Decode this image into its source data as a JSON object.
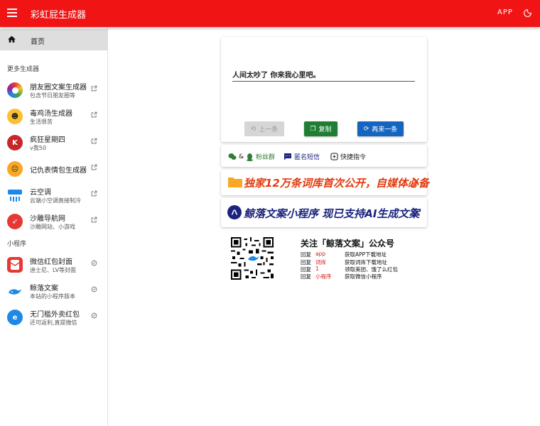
{
  "appbar": {
    "title": "彩虹屁生成器",
    "app_label": "APP"
  },
  "sidebar": {
    "home_label": "首页",
    "more_head": "更多生成器",
    "more_items": [
      {
        "title": "朋友圈文案生成器",
        "sub": "包含节日朋友圈等",
        "icon": "colorful-circle-icon"
      },
      {
        "title": "毒鸡汤生成器",
        "sub": "生活很苦",
        "icon": "emoji-face-icon"
      },
      {
        "title": "疯狂星期四",
        "sub": "v我50",
        "icon": "kfc-icon"
      },
      {
        "title": "记仇表情包生成器",
        "sub": "",
        "icon": "grudge-emoji-icon"
      },
      {
        "title": "云空调",
        "sub": "云端小空调直接制冷",
        "icon": "aircon-icon"
      },
      {
        "title": "沙雕导航网",
        "sub": "沙雕网站、小游戏",
        "icon": "compass-icon"
      }
    ],
    "mini_head": "小程序",
    "mini_items": [
      {
        "title": "微信红包封面",
        "sub": "迪士尼、LV等封面",
        "icon": "red-envelope-icon"
      },
      {
        "title": "鲸落文案",
        "sub": "本站的小程序版本",
        "icon": "whale-icon"
      },
      {
        "title": "无门槛外卖红包",
        "sub": "还可返利,直提微信",
        "icon": "ele-icon"
      }
    ]
  },
  "main": {
    "quote": "人间太吵了 你来我心里吧。",
    "prev_label": "上一条",
    "copy_label": "复制",
    "next_label": "再来一条",
    "links": {
      "fans": "粉丝群",
      "fans_prefix": "&",
      "sms": "匿名短信",
      "shortcut": "快捷指令"
    },
    "banner1": "独家12万条词库首次公开，自媒体必备",
    "banner2": "鲸落文案小程序 现已支持AI生成文案",
    "follow_title": "关注「鲸落文案」公众号",
    "reply_prefix": "回复",
    "replies": [
      {
        "kw": "app",
        "desc": "获取APP下载地址"
      },
      {
        "kw": "词库",
        "desc": "获取词库下载地址"
      },
      {
        "kw": "1",
        "desc": "领取美团、饿了么红包"
      },
      {
        "kw": "小程序",
        "desc": "获取微信小程序"
      }
    ]
  },
  "colors": {
    "appbar": "#f01414",
    "copy": "#1e7e34",
    "next": "#1565c0",
    "banner1": "#e23b0e",
    "banner2": "#1a237e"
  }
}
